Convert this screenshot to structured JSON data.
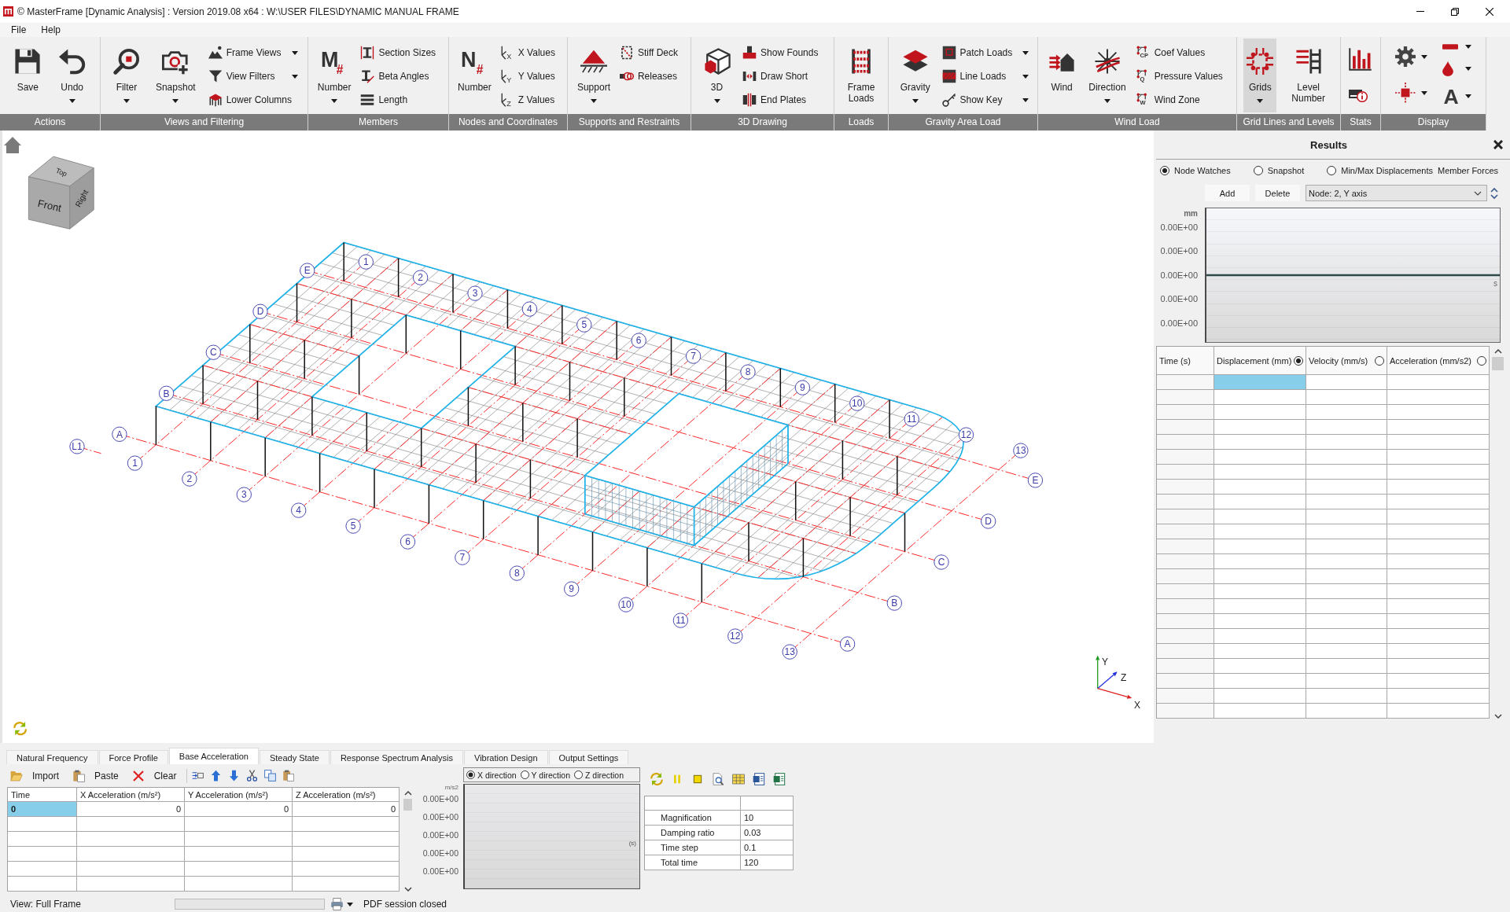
{
  "window": {
    "title": "© MasterFrame [Dynamic Analysis] : Version 2019.08 x64 : W:\\USER FILES\\DYNAMIC MANUAL FRAME"
  },
  "menu": [
    {
      "label": "File"
    },
    {
      "label": "Help"
    }
  ],
  "ribbon": [
    {
      "label": "Actions",
      "items": [
        {
          "kind": "large",
          "label": "Save",
          "dropdown": false,
          "selected": false
        },
        {
          "kind": "large",
          "label": "Undo",
          "dropdown": true,
          "selected": false
        }
      ]
    },
    {
      "label": "Views and Filtering",
      "items": [
        {
          "kind": "large",
          "label": "Filter",
          "dropdown": true,
          "selected": false
        },
        {
          "kind": "large",
          "label": "Snapshot",
          "dropdown": true,
          "selected": false
        },
        {
          "kind": "stack",
          "items": [
            {
              "label": "Frame Views",
              "dropdown": true,
              "selected": false
            },
            {
              "label": "View Filters",
              "dropdown": true,
              "selected": false
            },
            {
              "label": "Lower Columns",
              "dropdown": false,
              "selected": false
            }
          ]
        }
      ]
    },
    {
      "label": "Members",
      "items": [
        {
          "kind": "large",
          "label": "Number",
          "icon_text": "M",
          "icon_mark": "#",
          "dropdown": true,
          "selected": false
        },
        {
          "kind": "stack",
          "items": [
            {
              "label": "Section Sizes",
              "dropdown": false,
              "selected": false
            },
            {
              "label": "Beta Angles",
              "dropdown": false,
              "selected": false
            },
            {
              "label": "Length",
              "dropdown": false,
              "selected": false
            }
          ]
        }
      ]
    },
    {
      "label": "Nodes and Coordinates",
      "items": [
        {
          "kind": "large",
          "label": "Number",
          "icon_text": "N",
          "icon_mark": "#",
          "dropdown": false,
          "selected": false
        },
        {
          "kind": "stack",
          "items": [
            {
              "label": "X Values",
              "icon_text": "X",
              "dropdown": false,
              "selected": false
            },
            {
              "label": "Y Values",
              "icon_text": "Y",
              "dropdown": false,
              "selected": false
            },
            {
              "label": "Z Values",
              "icon_text": "Z",
              "dropdown": false,
              "selected": false
            }
          ]
        }
      ]
    },
    {
      "label": "Supports and Restraints",
      "items": [
        {
          "kind": "large",
          "label": "Support",
          "dropdown": true,
          "selected": false
        },
        {
          "kind": "stack",
          "items": [
            {
              "label": "Stiff Deck",
              "dropdown": false,
              "selected": false
            },
            {
              "label": "Releases",
              "dropdown": false,
              "selected": false
            }
          ]
        }
      ]
    },
    {
      "label": "3D Drawing",
      "items": [
        {
          "kind": "large",
          "label": "3D",
          "dropdown": true,
          "selected": false
        },
        {
          "kind": "stack",
          "items": [
            {
              "label": "Show Founds",
              "dropdown": false,
              "selected": false
            },
            {
              "label": "Draw Short",
              "dropdown": false,
              "selected": false
            },
            {
              "label": "End Plates",
              "dropdown": false,
              "selected": false
            }
          ]
        }
      ]
    },
    {
      "label": "Loads",
      "items": [
        {
          "kind": "large",
          "label": "Frame Loads",
          "dropdown": false,
          "selected": false
        }
      ]
    },
    {
      "label": "Gravity Area Load",
      "items": [
        {
          "kind": "large",
          "label": "Gravity",
          "dropdown": true,
          "selected": false
        },
        {
          "kind": "stack",
          "items": [
            {
              "label": "Patch Loads",
              "dropdown": true,
              "selected": false
            },
            {
              "label": "Line Loads",
              "dropdown": true,
              "selected": false
            },
            {
              "label": "Show Key",
              "dropdown": true,
              "selected": false
            }
          ]
        }
      ]
    },
    {
      "label": "Wind Load",
      "items": [
        {
          "kind": "large",
          "label": "Wind",
          "dropdown": false,
          "selected": false
        },
        {
          "kind": "large",
          "label": "Direction",
          "dropdown": true,
          "selected": false
        },
        {
          "kind": "stack",
          "items": [
            {
              "label": "Coef Values",
              "icon_text": "CP",
              "dropdown": false,
              "selected": false
            },
            {
              "label": "Pressure Values",
              "icon_text": "Q",
              "dropdown": false,
              "selected": false
            },
            {
              "label": "Wind Zone",
              "icon_text": "W",
              "dropdown": false,
              "selected": false
            }
          ]
        }
      ]
    },
    {
      "label": "Grid Lines and Levels",
      "items": [
        {
          "kind": "large",
          "label": "Grids",
          "dropdown": true,
          "selected": true
        },
        {
          "kind": "large",
          "label": "Level Number",
          "dropdown": false,
          "selected": false
        }
      ]
    },
    {
      "label": "Stats",
      "items": [
        {
          "kind": "icon_stack",
          "items": [
            {
              "dropdown": false,
              "selected": false
            },
            {
              "dropdown": false,
              "selected": false
            }
          ]
        }
      ]
    },
    {
      "label": "Display",
      "items": [
        {
          "kind": "icon_stack",
          "items": [
            {
              "dropdown": true,
              "selected": false
            },
            {
              "dropdown": true,
              "selected": false
            }
          ]
        },
        {
          "kind": "icon_stack",
          "items": [
            {
              "dropdown": true,
              "selected": false
            },
            {
              "dropdown": true,
              "selected": false
            },
            {
              "icon_text": "A",
              "dropdown": true,
              "selected": false
            }
          ]
        }
      ]
    }
  ],
  "viewport": {
    "view_cube": {
      "top": "Top",
      "front": "Front",
      "right": "Right"
    },
    "grid": {
      "numbered": [
        {
          "front": "1",
          "back": "1"
        },
        {
          "front": "2",
          "back": "2"
        },
        {
          "front": "3",
          "back": "3"
        },
        {
          "front": "4",
          "back": "4"
        },
        {
          "front": "5",
          "back": "5"
        },
        {
          "front": "6",
          "back": "6"
        },
        {
          "front": "7",
          "back": "7"
        },
        {
          "front": "8",
          "back": "8"
        },
        {
          "front": "9",
          "back": "9"
        },
        {
          "front": "10",
          "back": "10"
        },
        {
          "front": "11",
          "back": "11"
        },
        {
          "front": "12",
          "back": "12"
        },
        {
          "front": "13",
          "back": "13"
        }
      ],
      "lettered": [
        {
          "left": "A",
          "right": "A"
        },
        {
          "left": "B",
          "right": "B"
        },
        {
          "left": "C",
          "right": "C"
        },
        {
          "left": "D",
          "right": "D"
        },
        {
          "left": "E",
          "right": "E"
        }
      ],
      "level": "L1"
    },
    "axes": {
      "y": "Y",
      "z": "Z",
      "x": "X"
    }
  },
  "results_panel": {
    "title": "Results",
    "modes": [
      {
        "label": "Node Watches",
        "selected": true
      },
      {
        "label": "Snapshot",
        "selected": false
      },
      {
        "label": "Min/Max Displacements",
        "selected": false
      }
    ],
    "extra_mode": {
      "label": "Member Forces"
    },
    "buttons": [
      {
        "label": "Add"
      },
      {
        "label": "Delete"
      }
    ],
    "node_select": {
      "value": "Node: 2, Y axis"
    },
    "graph": {
      "y_unit": "mm",
      "y_tick_labels": [
        "0.00E+00",
        "0.00E+00",
        "0.00E+00",
        "0.00E+00",
        "0.00E+00"
      ],
      "x_unit": "s"
    },
    "table": {
      "columns": [
        {
          "kind": "plain",
          "label": "Time (s)"
        },
        {
          "kind": "radio",
          "label": "Displacement (mm)",
          "selected": true
        },
        {
          "kind": "radio",
          "label": "Velocity (mm/s)",
          "selected": false
        },
        {
          "kind": "radio",
          "label": "Acceleration (mm/s2)",
          "selected": false
        }
      ],
      "rows": [
        {
          "cells": [
            {
              "selected": false
            },
            {
              "selected": true
            },
            {
              "selected": false
            },
            {
              "selected": false
            }
          ]
        }
      ]
    }
  },
  "analysis_panel": {
    "tabs": [
      {
        "label": "Natural Frequency",
        "selected": false
      },
      {
        "label": "Force Profile",
        "selected": false
      },
      {
        "label": "Base Acceleration",
        "selected": true
      },
      {
        "label": "Steady State",
        "selected": false
      },
      {
        "label": "Response Spectrum Analysis",
        "selected": false
      },
      {
        "label": "Vibration Design",
        "selected": false
      },
      {
        "label": "Output Settings",
        "selected": false
      }
    ],
    "toolbar": [
      {
        "label": "Import"
      },
      {
        "label": "Paste"
      },
      {
        "label": "Clear"
      }
    ],
    "table": {
      "columns": [
        "Time",
        "X Acceleration (m/s²)",
        "Y Acceleration (m/s²)",
        "Z Acceleration (m/s²)"
      ],
      "rows": [
        {
          "cells": [
            {
              "text": "0",
              "selected": true
            },
            {
              "text": "0",
              "selected": false
            },
            {
              "text": "0",
              "selected": false
            },
            {
              "text": "0",
              "selected": false
            }
          ]
        }
      ]
    },
    "graph": {
      "directions": [
        {
          "label": "X direction",
          "selected": true
        },
        {
          "label": "Y direction",
          "selected": false
        },
        {
          "label": "Z direction",
          "selected": false
        }
      ],
      "y_unit": "m/s2",
      "y_tick_labels": [
        "0.00E+00",
        "0.00E+00",
        "0.00E+00",
        "0.00E+00",
        "0.00E+00"
      ],
      "x_unit": "(s)"
    },
    "settings": [
      {
        "label": "Magnification",
        "value": "10"
      },
      {
        "label": "Damping ratio",
        "value": "0.03"
      },
      {
        "label": "Time step",
        "value": "0.1"
      },
      {
        "label": "Total time",
        "value": "120"
      }
    ]
  },
  "status_bar": {
    "view": "View: Full Frame",
    "progress": {
      "level": 0
    },
    "message": "PDF session closed"
  }
}
